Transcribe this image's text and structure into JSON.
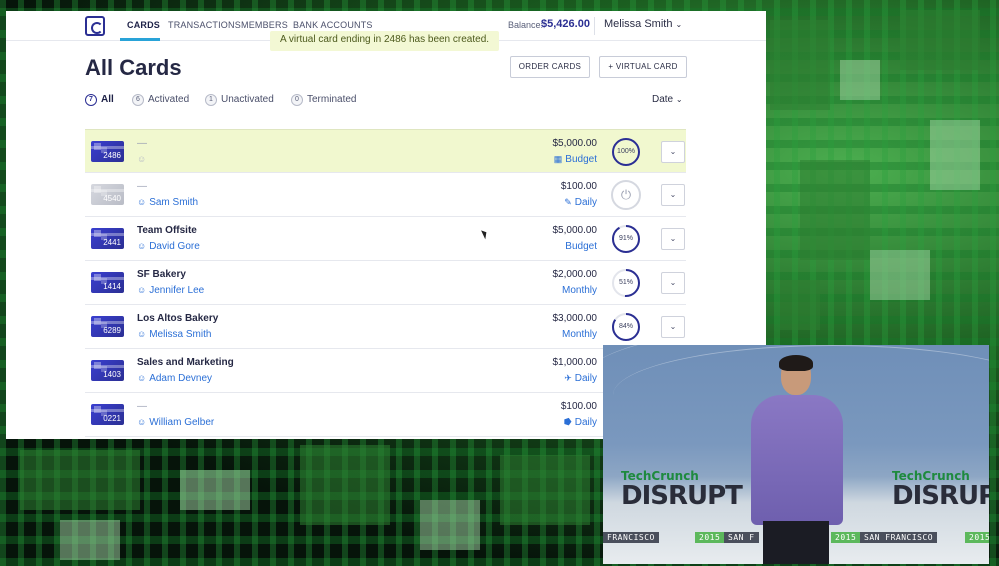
{
  "nav": {
    "tabs": [
      "CARDS",
      "TRANSACTIONS",
      "MEMBERS",
      "BANK ACCOUNTS"
    ],
    "active_tab": "CARDS",
    "balance_label": "Balance:",
    "balance_value": "$5,426.00",
    "user_name": "Melissa Smith"
  },
  "toast": "A virtual card ending in 2486 has been created.",
  "page_title": "All Cards",
  "actions": {
    "order_cards": "ORDER CARDS",
    "virtual_card": "+ VIRTUAL CARD"
  },
  "filters": [
    {
      "count": "7",
      "label": "All",
      "active": true
    },
    {
      "count": "6",
      "label": "Activated"
    },
    {
      "count": "1",
      "label": "Unactivated"
    },
    {
      "count": "0",
      "label": "Terminated"
    }
  ],
  "sort_label": "Date",
  "cards": [
    {
      "last4": "2486",
      "name": "—",
      "owner": "",
      "amount": "$5,000.00",
      "period": "Budget",
      "period_icon": "calendar-icon",
      "status": "gauge",
      "percent": 100,
      "percent_label": "100%"
    },
    {
      "last4": "4540",
      "name": "—",
      "owner": "Sam Smith",
      "amount": "$100.00",
      "period": "Daily",
      "period_icon": "pin-icon",
      "status": "power"
    },
    {
      "last4": "2441",
      "name": "Team Offsite",
      "owner": "David Gore",
      "amount": "$5,000.00",
      "period": "Budget",
      "period_icon": "",
      "status": "gauge",
      "percent": 91,
      "percent_label": "91%"
    },
    {
      "last4": "1414",
      "name": "SF Bakery",
      "owner": "Jennifer Lee",
      "amount": "$2,000.00",
      "period": "Monthly",
      "period_icon": "",
      "status": "gauge",
      "percent": 51,
      "percent_label": "51%"
    },
    {
      "last4": "6289",
      "name": "Los Altos Bakery",
      "owner": "Melissa Smith",
      "amount": "$3,000.00",
      "period": "Monthly",
      "period_icon": "",
      "status": "gauge",
      "percent": 84,
      "percent_label": "84%"
    },
    {
      "last4": "1403",
      "name": "Sales and Marketing",
      "owner": "Adam Devney",
      "amount": "$1,000.00",
      "period": "Daily",
      "period_icon": "plane-icon",
      "status": "none"
    },
    {
      "last4": "0221",
      "name": "—",
      "owner": "William Gelber",
      "amount": "$100.00",
      "period": "Daily",
      "period_icon": "car-icon",
      "status": "none"
    }
  ],
  "video": {
    "brand": "TechCrunch",
    "event": "DISRUPT",
    "year": "2015",
    "city": "SAN FRANCISCO",
    "city_fragment": "FRANCISCO",
    "city_fragment_short": "SAN F"
  },
  "colors": {
    "accent": "#2b2f93",
    "link": "#2b6fd6",
    "highlight": "#f1f8cf",
    "tab_underline": "#29a3d8"
  }
}
